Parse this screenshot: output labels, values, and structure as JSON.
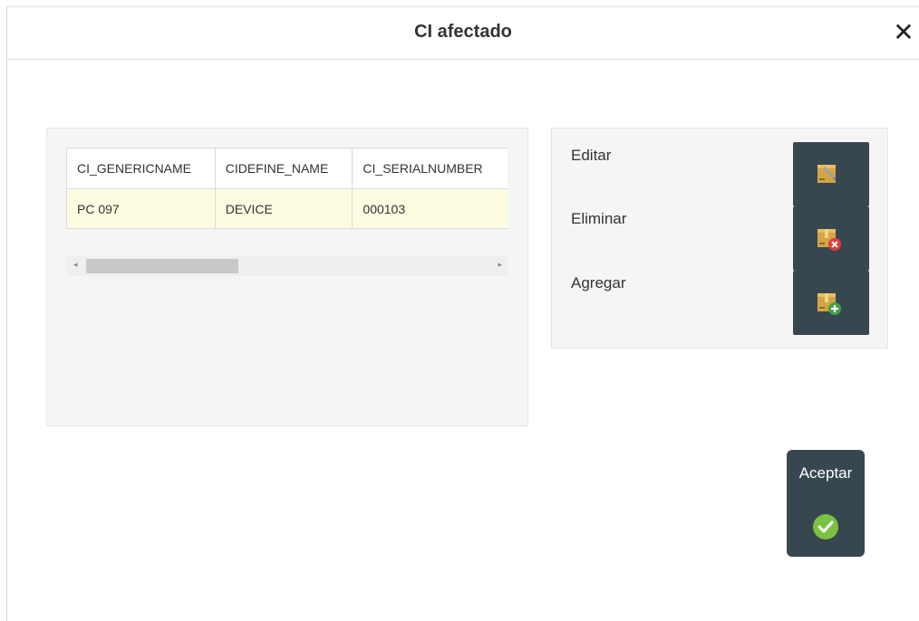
{
  "dialog": {
    "title": "CI afectado",
    "close_glyph": "✕"
  },
  "grid": {
    "columns": [
      "CI_GENERICNAME",
      "CIDEFINE_NAME",
      "CI_SERIALNUMBER"
    ],
    "rows": [
      [
        "PC 097",
        "DEVICE",
        "000103"
      ]
    ],
    "scroll_left_glyph": "◂",
    "scroll_right_glyph": "▸"
  },
  "actions": {
    "edit_label": "Editar",
    "edit_icon": "edit-box-icon",
    "delete_label": "Eliminar",
    "delete_icon": "delete-box-icon",
    "add_label": "Agregar",
    "add_icon": "add-box-icon"
  },
  "footer": {
    "accept_label": "Aceptar",
    "accept_icon": "check-circle-icon"
  },
  "colors": {
    "button_bg": "#37474f",
    "row_highlight": "#fdfce1",
    "panel_bg": "#f5f5f5",
    "delete_red": "#e53935",
    "add_green": "#43a047",
    "accept_green": "#7cc242"
  }
}
